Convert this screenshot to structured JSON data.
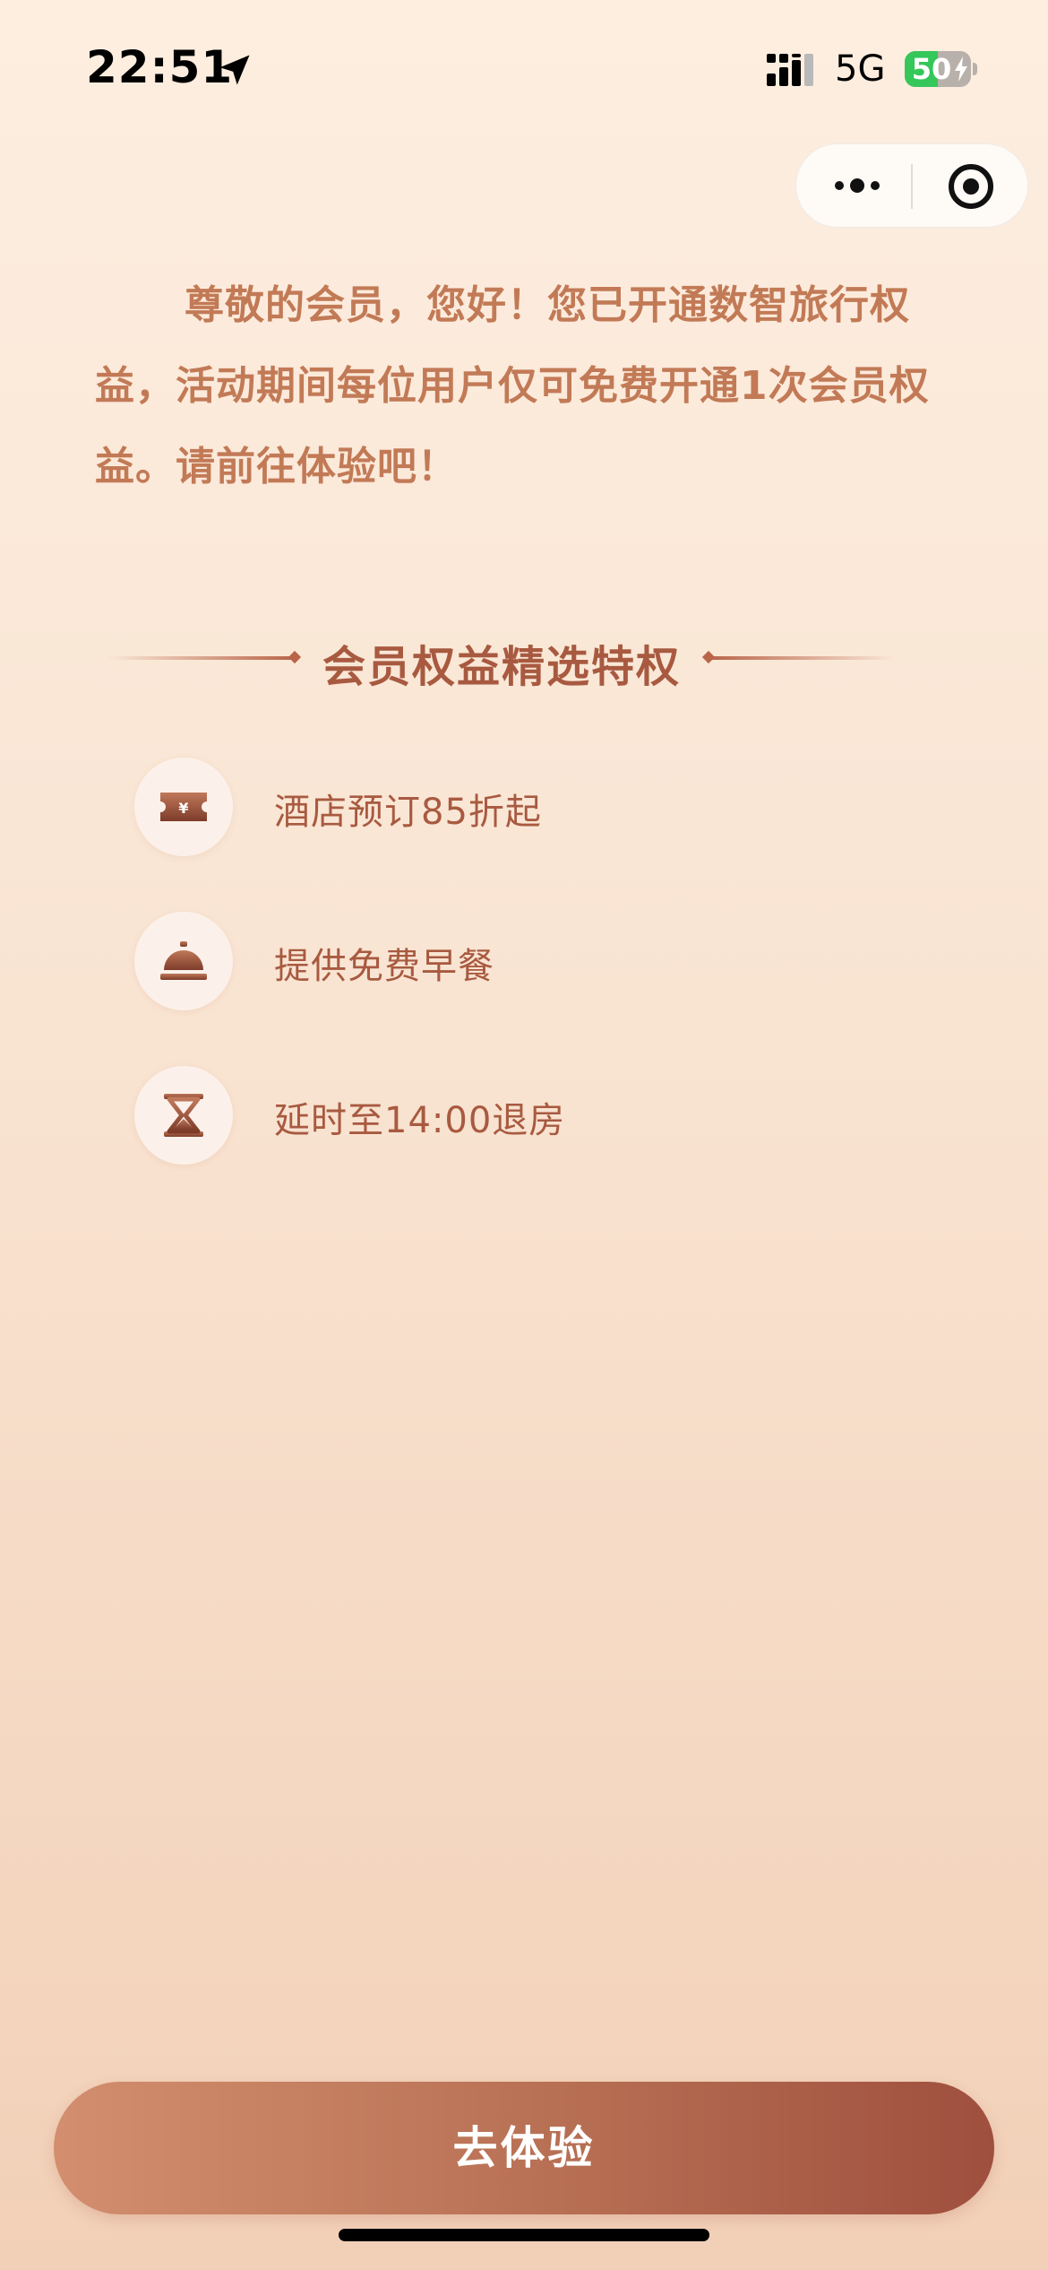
{
  "status_bar": {
    "time": "22:51",
    "network": "5G",
    "battery": "50",
    "battery_fraction": 0.5,
    "icons": [
      "location-arrow-icon",
      "signal-icon",
      "battery-charging-icon"
    ]
  },
  "capsule": {
    "icons": [
      "more-dots-icon",
      "close-target-icon"
    ]
  },
  "intro": {
    "text": "尊敬的会员，您好！您已开通数智旅行权益，活动期间每位用户仅可免费开通1次会员权益。请前往体验吧！"
  },
  "section": {
    "title": "会员权益精选特权"
  },
  "benefits": [
    {
      "label": "酒店预订85折起",
      "icon": "discount-ticket-icon"
    },
    {
      "label": "提供免费早餐",
      "icon": "service-bell-icon"
    },
    {
      "label": "延时至14:00退房",
      "icon": "hourglass-icon"
    }
  ],
  "cta": {
    "label": "去体验"
  },
  "colors": {
    "accent_text": "#a85a40",
    "intro_text": "#c27a56",
    "button_start": "#d28e6e",
    "button_end": "#9f4f3e",
    "battery_green": "#35c759"
  }
}
